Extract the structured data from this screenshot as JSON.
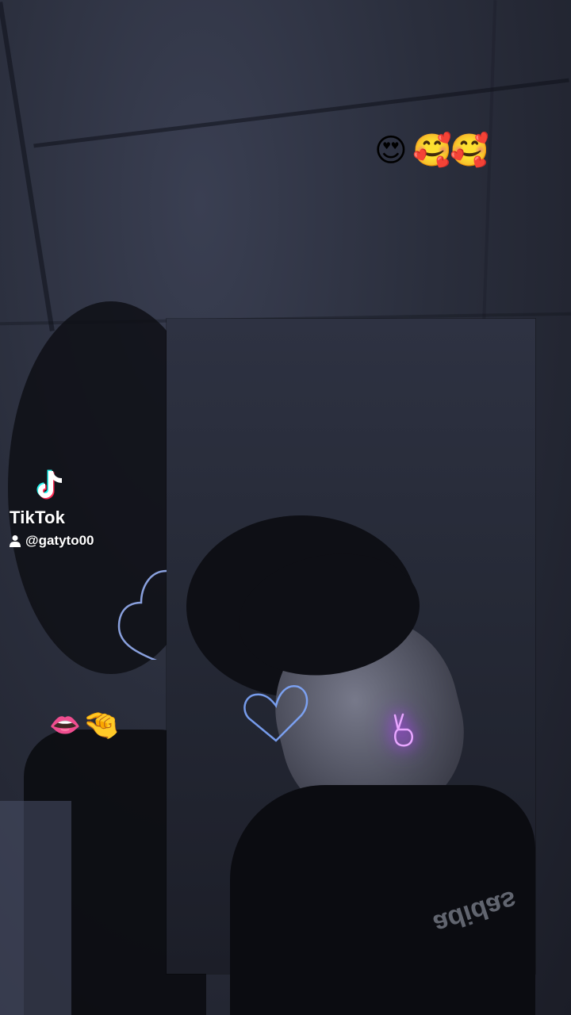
{
  "watermark": {
    "brand": "TikTok",
    "username": "@gatyto00"
  },
  "overlays": {
    "top_emojis": [
      "😍",
      "🥰",
      "🥰"
    ],
    "side_emojis": [
      "👄",
      "🤏"
    ]
  },
  "icons": {
    "tiktok_logo": "tiktok-logo-icon",
    "user": "user-icon",
    "neon_heart_left": "heart-outline-icon",
    "neon_heart_face": "heart-outline-icon",
    "neon_hand": "peace-hand-icon"
  },
  "colors": {
    "background": "#1c1f2b",
    "neon_heart": "#7fa9ff",
    "neon_hand": "#c04bff"
  }
}
